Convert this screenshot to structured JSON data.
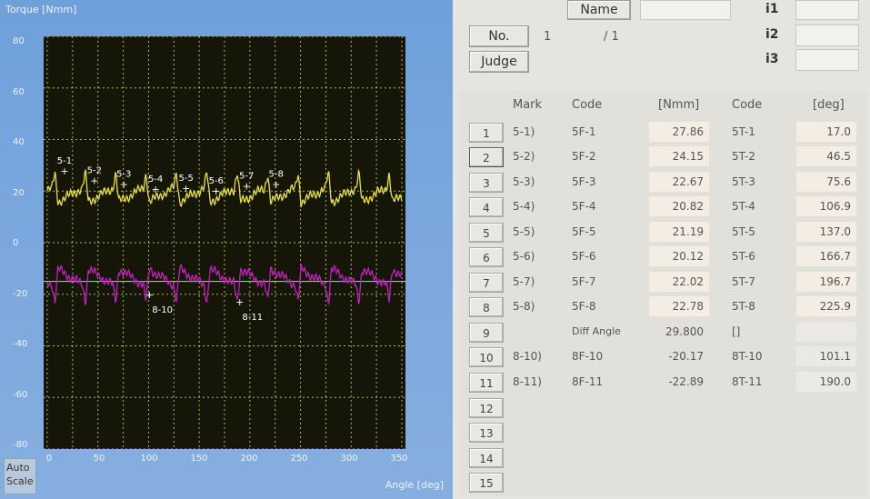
{
  "chart": {
    "ylabel": "Torque [Nmm]",
    "xlabel": "Angle [deg]",
    "yticks": [
      "80",
      "60",
      "40",
      "20",
      "0",
      "-20",
      "-40",
      "-60",
      "-80"
    ],
    "xticks": [
      "0",
      "50",
      "100",
      "150",
      "200",
      "250",
      "300",
      "350"
    ],
    "autoscale_label": "Auto Scale",
    "marks_top": [
      "5-1",
      "5-2",
      "5-3",
      "5-4",
      "5-5",
      "5-6",
      "5-7",
      "5-8"
    ],
    "marks_bottom": [
      "8-10",
      "8-11"
    ],
    "colors": {
      "series_a": "#e8e040",
      "series_b": "#c020c0",
      "baseline": "#40e0e0",
      "grid": "#e0f060",
      "plot_bg": "#161608"
    }
  },
  "chart_data": {
    "type": "line",
    "title": "",
    "xlabel": "Angle [deg]",
    "ylabel": "Torque [Nmm]",
    "xlim": [
      0,
      350
    ],
    "ylim": [
      -80,
      80
    ],
    "grid": true,
    "baseline_y": -15,
    "series": [
      {
        "color": "#e8e040",
        "peak_angles": [
          17.0,
          46.5,
          75.6,
          106.9,
          137.0,
          166.7,
          196.7,
          225.9
        ],
        "peak_values": [
          27.86,
          24.15,
          22.67,
          20.82,
          21.19,
          20.12,
          22.02,
          22.78
        ],
        "mean": 20,
        "amplitude": 7,
        "period": 30
      },
      {
        "color": "#c020c0",
        "trough_angles": [
          101.1,
          190.0
        ],
        "trough_values": [
          -20.17,
          -22.89
        ],
        "mean": -15,
        "amplitude": 8,
        "period": 30
      }
    ]
  },
  "header": {
    "name_label": "Name",
    "name_value": "",
    "no_label": "No.",
    "no_value": "1",
    "no_total": "/ 1",
    "judge_label": "Judge",
    "i1_label": "i1",
    "i2_label": "i2",
    "i3_label": "i3",
    "i1_value": "",
    "i2_value": "",
    "i3_value": ""
  },
  "table": {
    "headers": {
      "mark": "Mark",
      "code1": "Code",
      "unit1": "[Nmm]",
      "code2": "Code",
      "unit2": "[deg]"
    },
    "rows": [
      {
        "n": "1",
        "mark": "5-1)",
        "code1": "5F-1",
        "v1": "27.86",
        "code2": "5T-1",
        "v2": "17.0"
      },
      {
        "n": "2",
        "mark": "5-2)",
        "code1": "5F-2",
        "v1": "24.15",
        "code2": "5T-2",
        "v2": "46.5"
      },
      {
        "n": "3",
        "mark": "5-3)",
        "code1": "5F-3",
        "v1": "22.67",
        "code2": "5T-3",
        "v2": "75.6"
      },
      {
        "n": "4",
        "mark": "5-4)",
        "code1": "5F-4",
        "v1": "20.82",
        "code2": "5T-4",
        "v2": "106.9"
      },
      {
        "n": "5",
        "mark": "5-5)",
        "code1": "5F-5",
        "v1": "21.19",
        "code2": "5T-5",
        "v2": "137.0"
      },
      {
        "n": "6",
        "mark": "5-6)",
        "code1": "5F-6",
        "v1": "20.12",
        "code2": "5T-6",
        "v2": "166.7"
      },
      {
        "n": "7",
        "mark": "5-7)",
        "code1": "5F-7",
        "v1": "22.02",
        "code2": "5T-7",
        "v2": "196.7"
      },
      {
        "n": "8",
        "mark": "5-8)",
        "code1": "5F-8",
        "v1": "22.78",
        "code2": "5T-8",
        "v2": "225.9"
      },
      {
        "n": "9",
        "mark": "",
        "code1": "Diff Angle",
        "v1": "29.800",
        "code2": "[]",
        "v2": ""
      },
      {
        "n": "10",
        "mark": "8-10)",
        "code1": "8F-10",
        "v1": "-20.17",
        "code2": "8T-10",
        "v2": "101.1"
      },
      {
        "n": "11",
        "mark": "8-11)",
        "code1": "8F-11",
        "v1": "-22.89",
        "code2": "8T-11",
        "v2": "190.0"
      },
      {
        "n": "12",
        "mark": "",
        "code1": "",
        "v1": "",
        "code2": "",
        "v2": ""
      },
      {
        "n": "13",
        "mark": "",
        "code1": "",
        "v1": "",
        "code2": "",
        "v2": ""
      },
      {
        "n": "14",
        "mark": "",
        "code1": "",
        "v1": "",
        "code2": "",
        "v2": ""
      },
      {
        "n": "15",
        "mark": "",
        "code1": "",
        "v1": "",
        "code2": "",
        "v2": ""
      }
    ]
  }
}
